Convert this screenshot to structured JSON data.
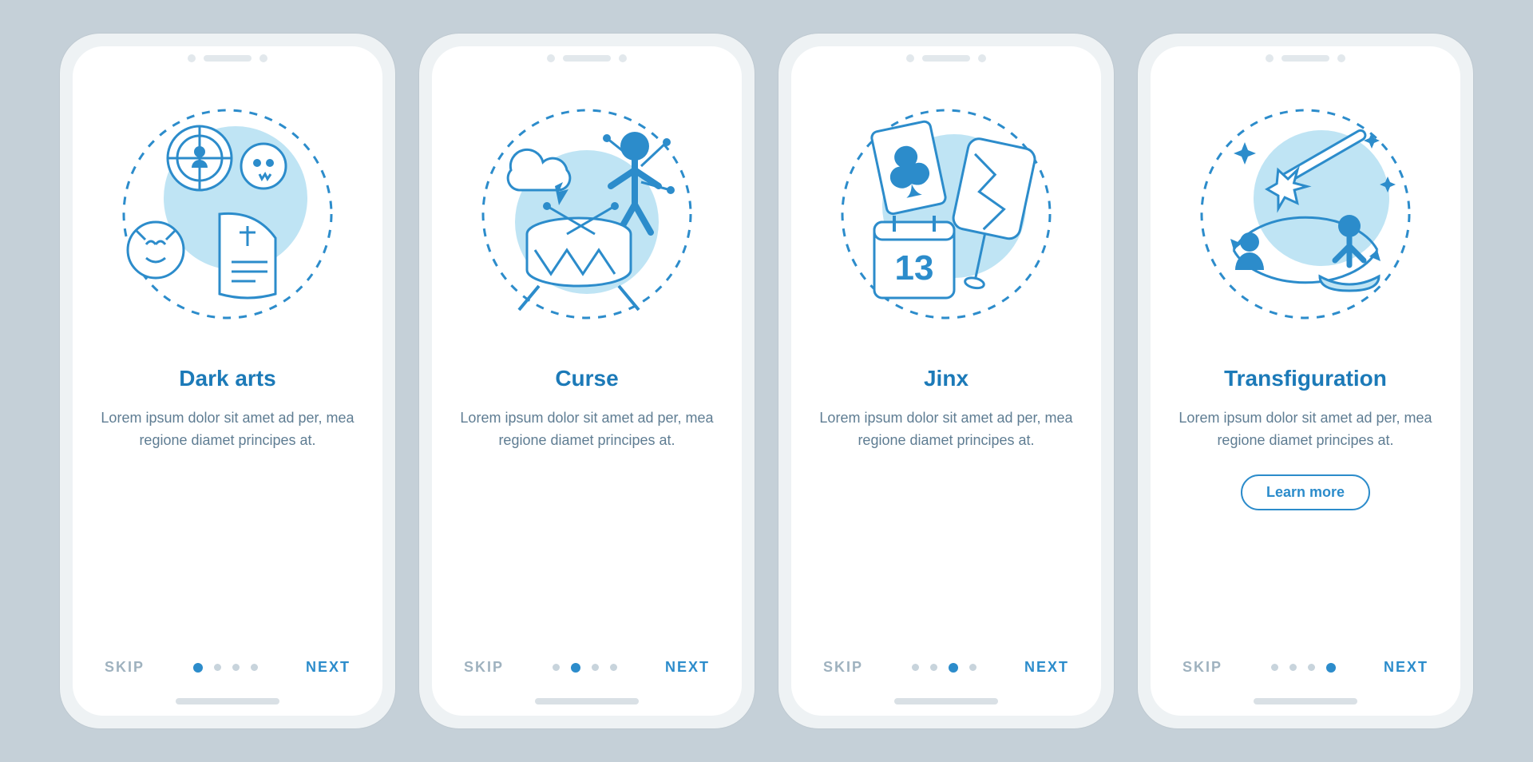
{
  "colors": {
    "primary": "#2c8ccb",
    "light_blue": "#bfe4f4",
    "stroke": "#2c8ccb",
    "background": "#c5d0d8",
    "muted_text": "#5f7d93",
    "skip_text": "#9fb2bf"
  },
  "screens": [
    {
      "title": "Dark arts",
      "description": "Lorem ipsum dolor sit amet ad per, mea regione diamet principes at.",
      "skip_label": "SKIP",
      "next_label": "NEXT",
      "active_dot": 0,
      "has_cta": false,
      "illustration": "dark-arts-icon"
    },
    {
      "title": "Curse",
      "description": "Lorem ipsum dolor sit amet ad per, mea regione diamet principes at.",
      "skip_label": "SKIP",
      "next_label": "NEXT",
      "active_dot": 1,
      "has_cta": false,
      "illustration": "curse-icon"
    },
    {
      "title": "Jinx",
      "description": "Lorem ipsum dolor sit amet ad per, mea regione diamet principes at.",
      "skip_label": "SKIP",
      "next_label": "NEXT",
      "active_dot": 2,
      "has_cta": false,
      "illustration": "jinx-icon",
      "jinx_number": "13"
    },
    {
      "title": "Transfiguration",
      "description": "Lorem ipsum dolor sit amet ad per, mea regione diamet principes at.",
      "skip_label": "SKIP",
      "next_label": "NEXT",
      "active_dot": 3,
      "has_cta": true,
      "cta_label": "Learn more",
      "illustration": "transfiguration-icon"
    }
  ],
  "total_dots": 4
}
